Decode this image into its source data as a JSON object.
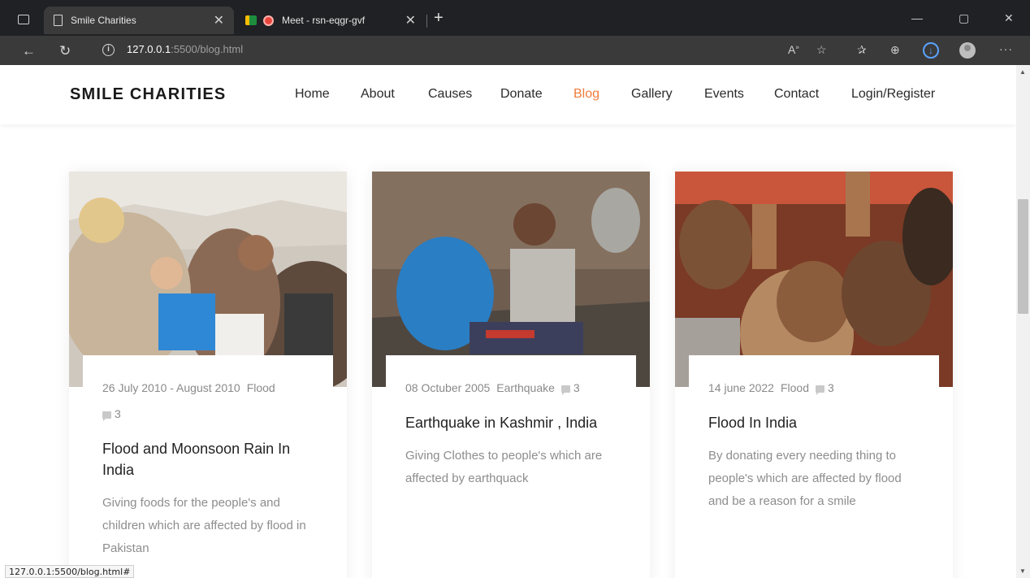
{
  "browser": {
    "tabs": [
      {
        "title": "Smile Charities",
        "active": true
      },
      {
        "title": "Meet - rsn-eqgr-gvf",
        "active": false
      }
    ],
    "url_host": "127.0.0.1",
    "url_path": ":5500/blog.html",
    "status_url": "127.0.0.1:5500/blog.html#"
  },
  "site": {
    "brand": "SMILE CHARITIES",
    "nav": [
      "Home",
      "About",
      "Causes",
      "Donate",
      "Blog",
      "Gallery",
      "Events",
      "Contact",
      "Login/Register"
    ],
    "active_nav": "Blog",
    "accent_color": "#f07c3a"
  },
  "posts": [
    {
      "date": "26 July 2010 - August 2010",
      "category": "Flood",
      "comments": "3",
      "title": "Flood and Moonsoon Rain In India",
      "description": "Giving foods for the people's and children which are affected by flood in Pakistan"
    },
    {
      "date": "08 Octuber 2005",
      "category": "Earthquake",
      "comments": "3",
      "title": "Earthquake in Kashmir , India",
      "description": "Giving Clothes to people's which are affected by earthquack"
    },
    {
      "date": "14 june 2022",
      "category": "Flood",
      "comments": "3",
      "title": "Flood In India",
      "description": "By donating every needing thing to people's which are affected by flood and be a reason for a smile"
    }
  ]
}
